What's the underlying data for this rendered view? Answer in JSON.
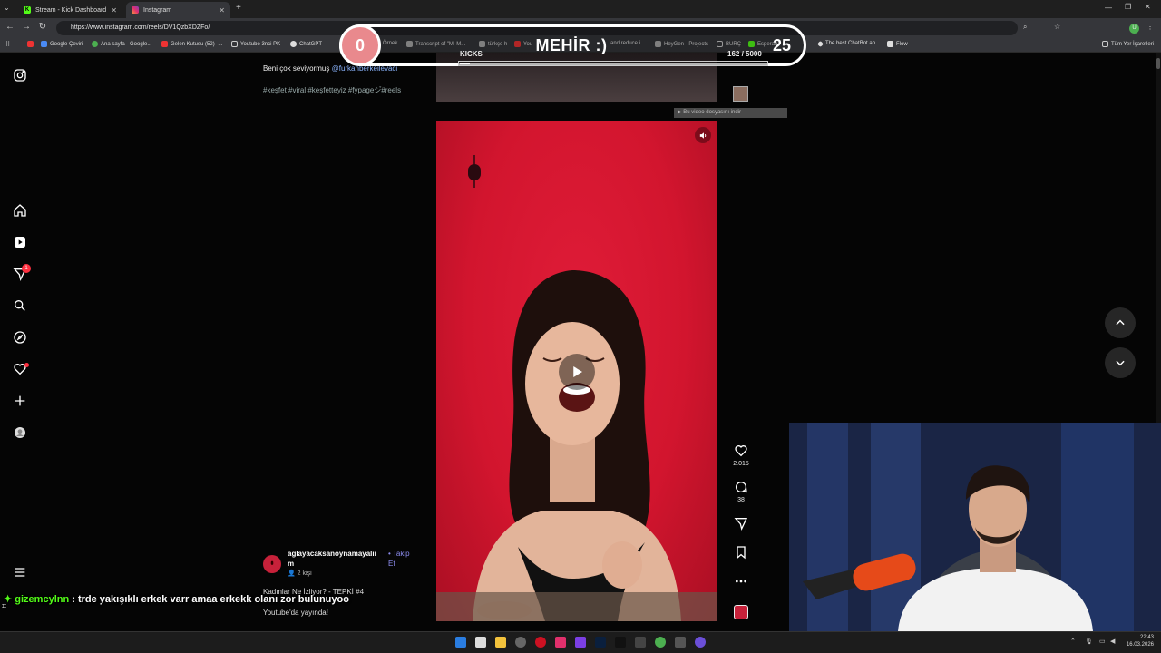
{
  "browser": {
    "tabs": [
      {
        "label": "Stream - Kick Dashboard",
        "active": false,
        "color": "#53fc18"
      },
      {
        "label": "Instagram",
        "active": true,
        "color": "#e1306c"
      }
    ],
    "url": "https://www.instagram.com/reels/DV1QzbXDZFo/",
    "bookmarks": [
      "Google Çeviri",
      "Ana sayfa - Google...",
      "Gelen Kutusu (52) -...",
      "Youtube 3nci PK",
      "ChatGPT",
      "Örnek",
      "Transcript of \"MI M...",
      "türkçe h",
      "You",
      "and reduce i...",
      "HeyGen - Projects",
      "BURÇ",
      "Esperan",
      "The best ChatBot an...",
      "Flow"
    ],
    "bookmarks_right": "Tüm Yer İşaretleri"
  },
  "post": {
    "caption_prefix": "Beni çok seviyormuş",
    "caption_mention": "@furkanberkeilevaci",
    "hashtags": "#keşfet #viral #keşfetteyiz #fypageシ゚#reels",
    "download_hint": "▶ Bu video dosyasını indir",
    "likes": "2.015",
    "comments": "38",
    "author": "aglayacaksanoynamayaliim",
    "follow": "Takip Et",
    "viewers": "2 kişi",
    "title": "Kadınlar Ne İzliyor? - TEPKİ #4",
    "subtitle": "Youtube'da yayında!"
  },
  "overlay": {
    "goal_left": "0",
    "goal_title": "MEHİR :)",
    "goal_right": "25",
    "kicks_label": "KICKS",
    "kicks_count": "162 / 5000",
    "kicks_fraction": 0.0324
  },
  "chat": {
    "user": "gizemcylnn",
    "message": ": trde yakışıklı erkek varr amaa erkekk olanı zor bulunuyoo"
  },
  "clock": {
    "time": "22:43",
    "date": "16.03.2026"
  },
  "colors": {
    "kick_green": "#53fc18",
    "instagram_red": "#e01c38",
    "accent_blue": "#8bb5ff"
  }
}
